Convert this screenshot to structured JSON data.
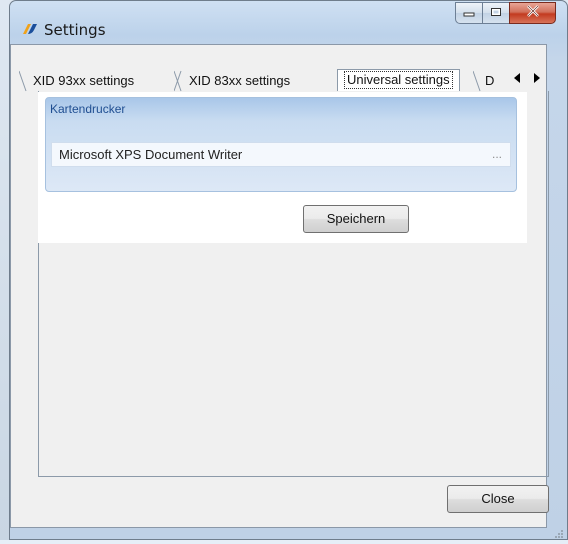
{
  "window": {
    "title": "Settings",
    "icon": "app-logo-icon",
    "caption_buttons": [
      "minimize-icon",
      "maximize-icon",
      "close-icon"
    ]
  },
  "tabs": [
    {
      "label": "XID 93xx settings",
      "active": false
    },
    {
      "label": "XID 83xx settings",
      "active": false
    },
    {
      "label": "Universal settings",
      "active": true
    },
    {
      "label": "D",
      "active": false
    }
  ],
  "tab_scroll": {
    "left_icon": "arrow-left-icon",
    "right_icon": "arrow-right-icon"
  },
  "group": {
    "title": "Kartendrucker",
    "printer_value": "Microsoft XPS Document Writer",
    "browse_label": "..."
  },
  "buttons": {
    "save_label": "Speichern",
    "close_label": "Close"
  },
  "colors": {
    "group_title": "#1f4e91",
    "close_caption": "#c33b20"
  }
}
